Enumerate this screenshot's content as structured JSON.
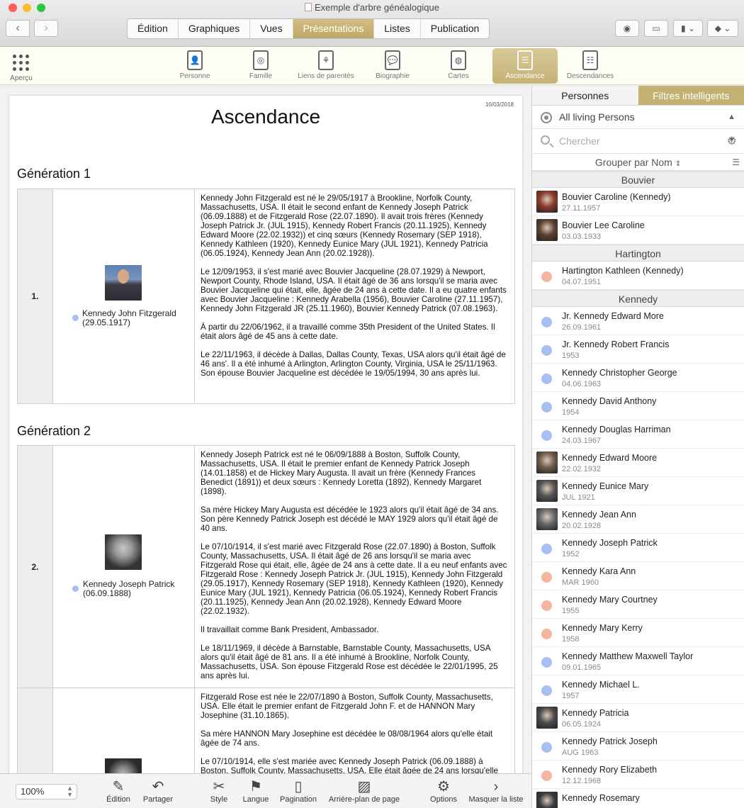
{
  "window": {
    "title": "Exemple d'arbre généalogique"
  },
  "main_tabs": [
    {
      "label": "Édition",
      "active": false
    },
    {
      "label": "Graphiques",
      "active": false
    },
    {
      "label": "Vues",
      "active": false
    },
    {
      "label": "Présentations",
      "active": true
    },
    {
      "label": "Listes",
      "active": false
    },
    {
      "label": "Publication",
      "active": false
    }
  ],
  "views": {
    "apercu": "Aperçu",
    "items": [
      {
        "label": "Personne",
        "icon": "person-report-icon",
        "active": false
      },
      {
        "label": "Famille",
        "icon": "family-report-icon",
        "active": false
      },
      {
        "label": "Liens de parentés",
        "icon": "relationship-report-icon",
        "active": false
      },
      {
        "label": "Biographie",
        "icon": "biography-report-icon",
        "active": false
      },
      {
        "label": "Cartes",
        "icon": "maps-report-icon",
        "active": false
      },
      {
        "label": "Ascendance",
        "icon": "ancestors-report-icon",
        "active": true
      },
      {
        "label": "Descendances",
        "icon": "descendants-report-icon",
        "active": false
      }
    ]
  },
  "report": {
    "date": "10/03/2018",
    "title": "Ascendance",
    "gen1_title": "Génération 1",
    "gen2_title": "Génération 2",
    "entries": [
      {
        "num": "1.",
        "name": "Kennedy John Fitzgerald",
        "date": "(29.05.1917)",
        "paragraphs": [
          "Kennedy John Fitzgerald est né le 29/05/1917 à Brookline, Norfolk County, Massachusetts, USA. Il était le second enfant de Kennedy Joseph Patrick (06.09.1888) et de Fitzgerald Rose (22.07.1890). Il avait trois frères (Kennedy Joseph Patrick Jr. (JUL 1915), Kennedy Robert Francis (20.11.1925), Kennedy Edward Moore (22.02.1932)) et cinq sœurs (Kennedy Rosemary (SEP 1918), Kennedy Kathleen (1920), Kennedy Eunice Mary (JUL 1921), Kennedy Patricia (06.05.1924), Kennedy Jean Ann (20.02.1928)).",
          "Le 12/09/1953, il s'est marié avec Bouvier Jacqueline (28.07.1929) à Newport, Newport County, Rhode Island, USA. Il était âgé de 36 ans lorsqu'il se maria avec Bouvier Jacqueline qui était, elle, âgée de 24 ans à cette date. Il a eu quatre enfants avec Bouvier Jacqueline : Kennedy Arabella (1956), Bouvier Caroline (27.11.1957), Kennedy John Fitzgerald JR (25.11.1960), Bouvier Kennedy Patrick (07.08.1963).",
          "À partir du 22/06/1962, il a travaillé comme 35th President of the United States. Il était alors âgé de 45 ans à cette date.",
          "Le 22/11/1963, il décède à Dallas, Dallas County, Texas, USA alors qu'il était âgé de 46 ans'. Il a été inhumé à Arlington, Arlington County, Virginia, USA le 25/11/1963. Son épouse Bouvier Jacqueline est décédée le 19/05/1994, 30 ans après lui."
        ]
      },
      {
        "num": "2.",
        "name": "Kennedy Joseph Patrick",
        "date": "(06.09.1888)",
        "paragraphs": [
          "Kennedy Joseph Patrick est né le 06/09/1888 à Boston, Suffolk County, Massachusetts, USA. Il était le premier enfant de Kennedy Patrick Joseph (14.01.1858) et de Hickey Mary Augusta. Il avait un frère (Kennedy Frances Benedict (1891)) et deux sœurs : Kennedy Loretta (1892), Kennedy Margaret (1898).",
          "Sa mère Hickey Mary Augusta est décédée le 1923 alors qu'il était âgé de 34 ans. Son père Kennedy Patrick Joseph est décédé le MAY 1929 alors qu'il était âgé de 40 ans.",
          "Le 07/10/1914, il s'est marié avec Fitzgerald Rose (22.07.1890) à Boston, Suffolk County, Massachusetts, USA. Il était âgé de 26 ans lorsqu'il se maria avec Fitzgerald Rose qui était, elle, âgée de 24 ans à cette date. Il a eu neuf enfants avec Fitzgerald Rose : Kennedy Joseph Patrick Jr. (JUL 1915), Kennedy John Fitzgerald (29.05.1917), Kennedy Rosemary (SEP 1918), Kennedy Kathleen (1920), Kennedy Eunice Mary (JUL 1921), Kennedy Patricia (06.05.1924), Kennedy Robert Francis (20.11.1925), Kennedy Jean Ann (20.02.1928), Kennedy Edward Moore (22.02.1932).",
          "Il travaillait comme Bank President, Ambassador.",
          "Le 18/11/1969, il décède à Barnstable, Barnstable County, Massachusetts, USA alors qu'il était âgé de 81 ans. Il a été inhumé à Brookline, Norfolk County, Massachusetts, USA. Son épouse Fitzgerald Rose est décédée le 22/01/1995, 25 ans après lui."
        ]
      },
      {
        "num": "",
        "name": "",
        "date": "",
        "paragraphs": [
          "Fitzgerald Rose est née le 22/07/1890 à Boston, Suffolk County, Massachusetts, USA. Elle était le premier enfant de Fitzgerald John F. et de HANNON Mary Josephine (31.10.1865).",
          "Sa mère HANNON Mary Josephine est décédée le 08/08/1964 alors qu'elle était âgée de 74 ans.",
          "Le 07/10/1914, elle s'est mariée avec Kennedy Joseph Patrick (06.09.1888) à Boston, Suffolk County, Massachusetts, USA. Elle était âgée de 24 ans lorsqu'elle"
        ]
      }
    ]
  },
  "bottom_bar": {
    "zoom": "100%",
    "buttons": [
      {
        "label": "Édition",
        "icon": "pencil-icon"
      },
      {
        "label": "Partager",
        "icon": "share-icon"
      },
      {
        "label": "Style",
        "icon": "style-icon"
      },
      {
        "label": "Langue",
        "icon": "flag-icon"
      },
      {
        "label": "Pagination",
        "icon": "page-icon"
      },
      {
        "label": "Arrière-plan de page",
        "icon": "background-image-icon"
      },
      {
        "label": "Options",
        "icon": "gear-icon"
      },
      {
        "label": "Masquer la liste",
        "icon": "chevron-right-icon"
      }
    ]
  },
  "sidebar": {
    "tabs": [
      {
        "label": "Personnes",
        "active": false
      },
      {
        "label": "Filtres intelligents",
        "active": true
      }
    ],
    "filter": "All living Persons",
    "search_placeholder": "Chercher",
    "group_by": "Grouper par Nom",
    "groups": [
      {
        "name": "Bouvier",
        "people": [
          {
            "name": "Bouvier Caroline (Kennedy)",
            "date": "27.11.1957",
            "photo": true,
            "color": "#8a3a2a"
          },
          {
            "name": "Bouvier Lee Caroline",
            "date": "03.03.1933",
            "photo": true,
            "color": "#5a4030"
          }
        ]
      },
      {
        "name": "Hartington",
        "people": [
          {
            "name": "Hartington Kathleen (Kennedy)",
            "date": "04.07.1951",
            "photo": false,
            "color": "#f5b6a0"
          }
        ]
      },
      {
        "name": "Kennedy",
        "people": [
          {
            "name": "Jr. Kennedy Edward More",
            "date": "26.09.1961",
            "photo": false,
            "color": "#a7bff0"
          },
          {
            "name": "Jr. Kennedy Robert Francis",
            "date": "1953",
            "photo": false,
            "color": "#a7bff0"
          },
          {
            "name": "Kennedy Christopher George",
            "date": "04.06.1963",
            "photo": false,
            "color": "#a7bff0"
          },
          {
            "name": "Kennedy David Anthony",
            "date": "1954",
            "photo": false,
            "color": "#a7bff0"
          },
          {
            "name": "Kennedy Douglas Harriman",
            "date": "24.03.1967",
            "photo": false,
            "color": "#a7bff0"
          },
          {
            "name": "Kennedy Edward Moore",
            "date": "22.02.1932",
            "photo": true,
            "color": "#6e5a48"
          },
          {
            "name": "Kennedy Eunice Mary",
            "date": "JUL 1921",
            "photo": true,
            "color": "#555555"
          },
          {
            "name": "Kennedy Jean Ann",
            "date": "20.02.1928",
            "photo": true,
            "color": "#666666"
          },
          {
            "name": "Kennedy Joseph Patrick",
            "date": "1952",
            "photo": false,
            "color": "#a7bff0"
          },
          {
            "name": "Kennedy Kara Ann",
            "date": "MAR 1960",
            "photo": false,
            "color": "#f5b6a0"
          },
          {
            "name": "Kennedy Mary Courtney",
            "date": "1955",
            "photo": false,
            "color": "#f5b6a0"
          },
          {
            "name": "Kennedy Mary Kerry",
            "date": "1958",
            "photo": false,
            "color": "#f5b6a0"
          },
          {
            "name": "Kennedy Matthew Maxwell Taylor",
            "date": "09.01.1965",
            "photo": false,
            "color": "#a7bff0"
          },
          {
            "name": "Kennedy Michael L.",
            "date": "1957",
            "photo": false,
            "color": "#a7bff0"
          },
          {
            "name": "Kennedy Patricia",
            "date": "06.05.1924",
            "photo": true,
            "color": "#4a4a4a"
          },
          {
            "name": "Kennedy Patrick Joseph",
            "date": "AUG 1963",
            "photo": false,
            "color": "#a7bff0"
          },
          {
            "name": "Kennedy Rory Elizabeth",
            "date": "12.12.1968",
            "photo": false,
            "color": "#f5b6a0"
          },
          {
            "name": "Kennedy Rosemary",
            "date": "",
            "photo": true,
            "color": "#3a3a3a"
          }
        ]
      }
    ]
  },
  "colors": {
    "accent": "#c3b073",
    "male": "#a7bff0",
    "female": "#f5b6a0"
  }
}
